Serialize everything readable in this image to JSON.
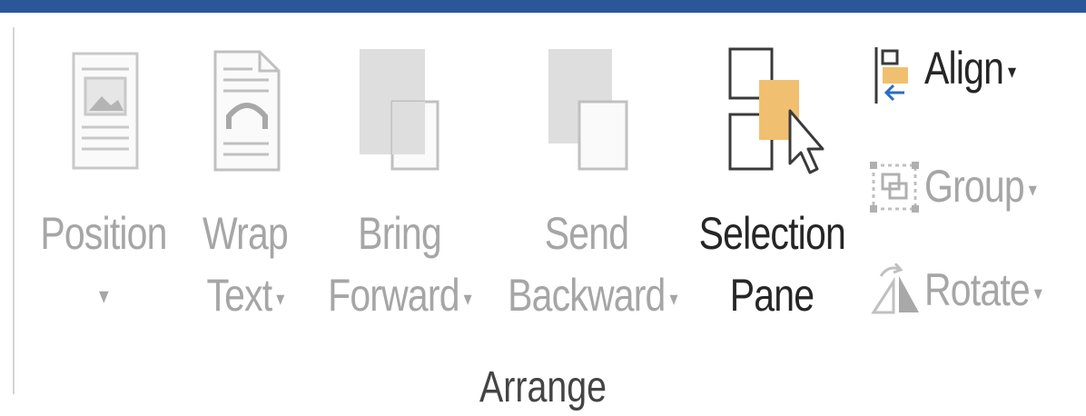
{
  "group": {
    "label": "Arrange"
  },
  "buttons": {
    "position": {
      "line1": "Position",
      "caret": "▾",
      "enabled": false
    },
    "wrap_text": {
      "line1": "Wrap",
      "line2": "Text",
      "caret": "▾",
      "enabled": false
    },
    "bring_forward": {
      "line1": "Bring",
      "line2": "Forward",
      "caret": "▾",
      "enabled": false
    },
    "send_backward": {
      "line1": "Send",
      "line2": "Backward",
      "caret": "▾",
      "enabled": false
    },
    "selection_pane": {
      "line1": "Selection",
      "line2": "Pane",
      "enabled": true
    },
    "align": {
      "label": "Align",
      "caret": "▾",
      "enabled": true
    },
    "group": {
      "label": "Group",
      "caret": "▾",
      "enabled": false
    },
    "rotate": {
      "label": "Rotate",
      "caret": "▾",
      "enabled": false
    }
  },
  "colors": {
    "title_bar": "#2b579a",
    "disabled_text": "#a6a6a6",
    "enabled_text": "#262626",
    "accent_orange": "#f0c070"
  }
}
